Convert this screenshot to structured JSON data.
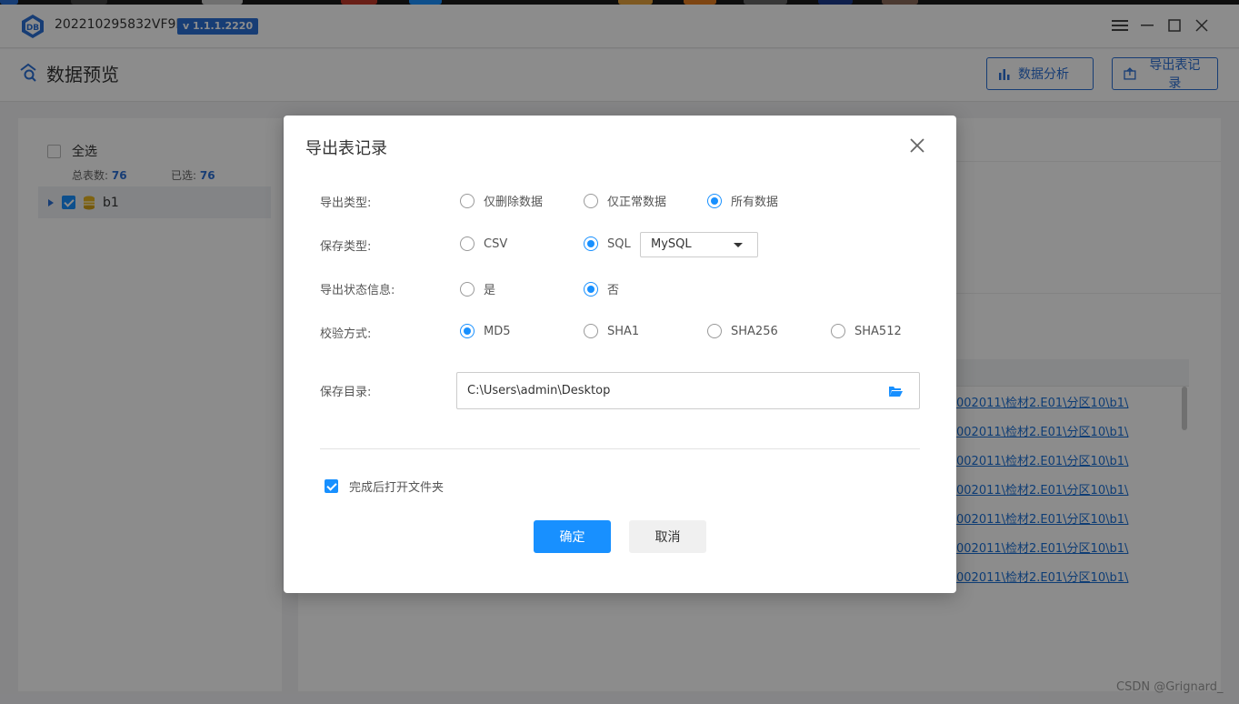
{
  "window": {
    "app_id": "202210295832VF9F",
    "version": "v 1.1.1.2220",
    "menu_icon": "menu-icon",
    "minimize_icon": "minimize-icon",
    "maximize_icon": "maximize-icon",
    "close_icon": "close-icon"
  },
  "header": {
    "title": "数据预览",
    "analyze_button": "数据分析",
    "export_button": "导出表记录"
  },
  "left_panel": {
    "select_all_label": "全选",
    "total_label": "总表数:",
    "total_value": "76",
    "selected_label": "已选:",
    "selected_value": "76",
    "tree_item": "b1"
  },
  "background_links": [
    "002011\\检材2.E01\\分区10\\b1\\",
    "002011\\检材2.E01\\分区10\\b1\\",
    "002011\\检材2.E01\\分区10\\b1\\",
    "002011\\检材2.E01\\分区10\\b1\\",
    "002011\\检材2.E01\\分区10\\b1\\",
    "002011\\检材2.E01\\分区10\\b1\\",
    "002011\\检材2.E01\\分区10\\b1\\"
  ],
  "dialog": {
    "title": "导出表记录",
    "export_type": {
      "label": "导出类型:",
      "options": [
        "仅删除数据",
        "仅正常数据",
        "所有数据"
      ],
      "selected": "所有数据"
    },
    "save_type": {
      "label": "保存类型:",
      "options": [
        "CSV",
        "SQL"
      ],
      "selected": "SQL",
      "sql_dialect": "MySQL"
    },
    "export_status": {
      "label": "导出状态信息:",
      "options": [
        "是",
        "否"
      ],
      "selected": "否"
    },
    "checksum": {
      "label": "校验方式:",
      "options": [
        "MD5",
        "SHA1",
        "SHA256",
        "SHA512"
      ],
      "selected": "MD5"
    },
    "save_dir": {
      "label": "保存目录:",
      "value": "C:\\Users\\admin\\Desktop"
    },
    "open_folder_label": "完成后打开文件夹",
    "open_folder_checked": true,
    "confirm_button": "确定",
    "cancel_button": "取消"
  },
  "watermark": "CSDN @Grignard_",
  "colors": {
    "accent": "#1890ff",
    "brand_blue": "#2a6fd6"
  }
}
